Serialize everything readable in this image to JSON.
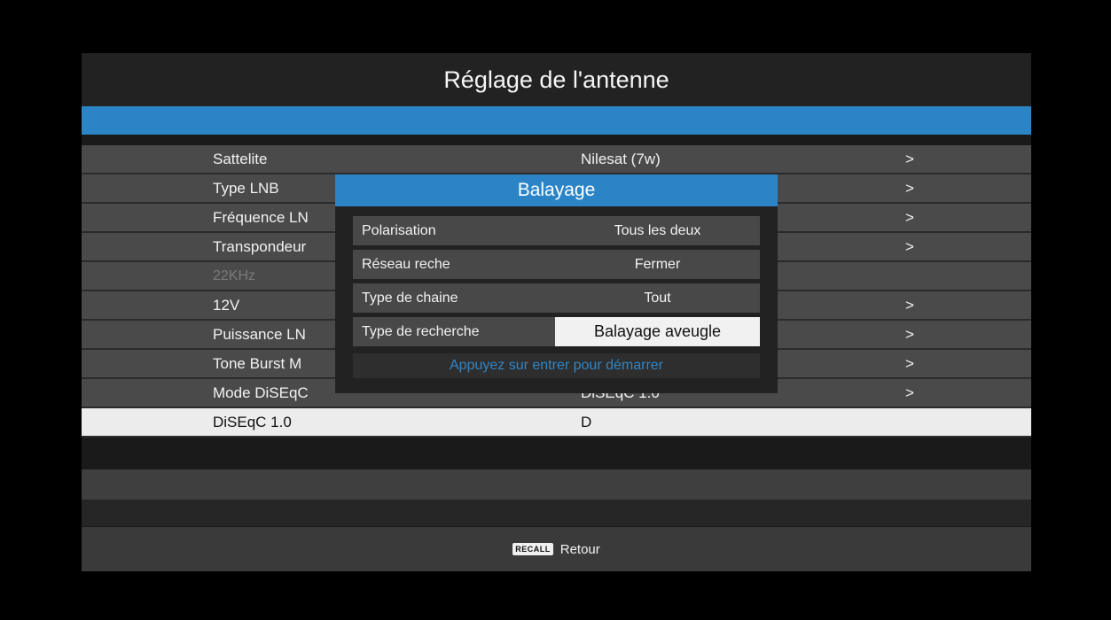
{
  "screen": {
    "title": "Réglage de l'antenne"
  },
  "menu": {
    "rows": [
      {
        "label": "Sattelite",
        "value": "Nilesat (7w)",
        "chevron": ">"
      },
      {
        "label": "Type LNB",
        "value": "",
        "chevron": ">"
      },
      {
        "label": "Fréquence LN",
        "value": "",
        "chevron": ">"
      },
      {
        "label": "Transpondeur",
        "value": "",
        "chevron": ">"
      },
      {
        "label": "22KHz",
        "value": "",
        "chevron": ""
      },
      {
        "label": "12V",
        "value": "",
        "chevron": ">"
      },
      {
        "label": "Puissance LN",
        "value": "",
        "chevron": ">"
      },
      {
        "label": "Tone Burst M",
        "value": "",
        "chevron": ">"
      },
      {
        "label": "Mode DiSEqC",
        "value": "DiSEqC 1.0",
        "chevron": ">"
      },
      {
        "label": "DiSEqC 1.0",
        "value": "D",
        "chevron": ""
      }
    ]
  },
  "popup": {
    "title": "Balayage",
    "rows": [
      {
        "label": "Polarisation",
        "value": "Tous les deux"
      },
      {
        "label": "Réseau reche",
        "value": "Fermer"
      },
      {
        "label": "Type de chaine",
        "value": "Tout"
      },
      {
        "label": "Type de recherche",
        "value": "Balayage aveugle"
      }
    ],
    "hint": "Appuyez sur entrer pour démarrer"
  },
  "footer": {
    "recall_key": "RECALL",
    "recall_label": "Retour"
  },
  "colors": {
    "accent_blue": "#2a84c6",
    "hint_blue": "#2f86c8"
  }
}
